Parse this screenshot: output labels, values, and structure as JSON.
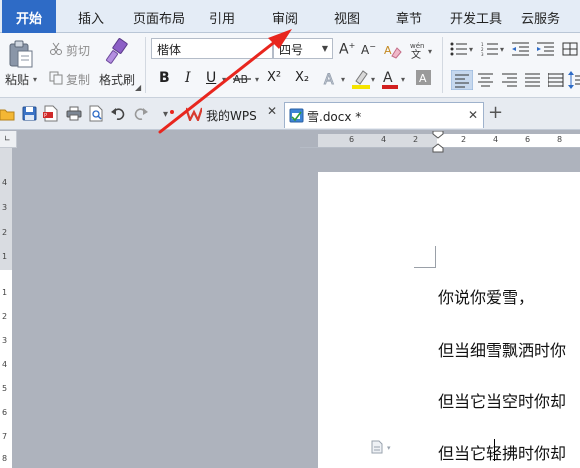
{
  "tabs": [
    {
      "label": "开始",
      "active": true
    },
    {
      "label": "插入"
    },
    {
      "label": "页面布局"
    },
    {
      "label": "引用"
    },
    {
      "label": "审阅"
    },
    {
      "label": "视图"
    },
    {
      "label": "章节"
    },
    {
      "label": "开发工具"
    },
    {
      "label": "云服务"
    }
  ],
  "clipboard": {
    "paste": "粘贴",
    "cut": "剪切",
    "copy": "复制",
    "format_painter": "格式刷"
  },
  "font": {
    "family": "楷体",
    "size": "四号"
  },
  "format_buttons": {
    "bold": "B",
    "italic": "I",
    "underline": "U",
    "superscript": "X²",
    "subscript": "X₂",
    "font_color": "A"
  },
  "doc_tabs": [
    {
      "label": "我的WPS"
    },
    {
      "label": "雪.docx *",
      "active": true
    }
  ],
  "ruler": {
    "horizontal": [
      "6",
      "4",
      "2",
      "2",
      "4",
      "6",
      "8"
    ],
    "vertical": [
      "4",
      "3",
      "2",
      "1",
      "1",
      "2",
      "3",
      "4",
      "5",
      "6",
      "7",
      "8",
      "9"
    ]
  },
  "document": {
    "paragraphs": [
      "你说你爱雪，",
      "但当细雪飘洒时你",
      "但当它当空时你却",
      "但当它轻拂时你却"
    ]
  },
  "colors": {
    "accent": "#2e6bc6",
    "annotation": "#e8261e",
    "highlight_yellow": "#f5e400",
    "font_red": "#d22020"
  }
}
